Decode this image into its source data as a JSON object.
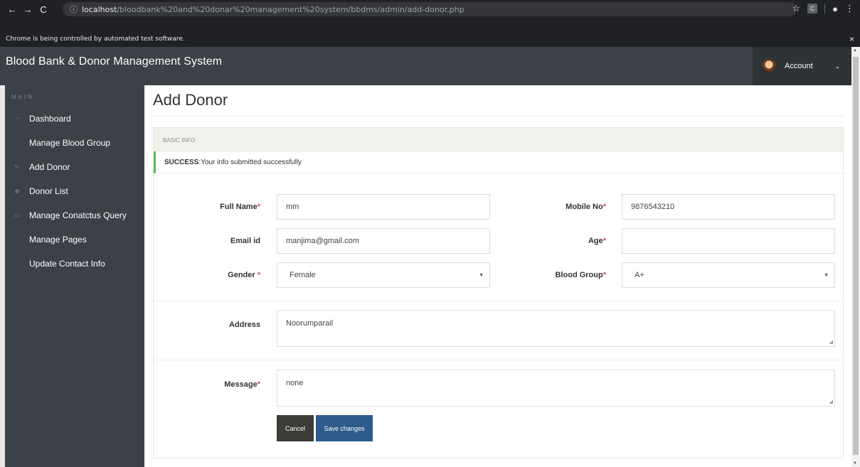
{
  "browser": {
    "url_host": "localhost",
    "url_path": "/bloodbank%20and%20donar%20management%20system/bbdms/admin/add-donor.php",
    "automation_notice": "Chrome is being controlled by automated test software.",
    "extension_label": "C"
  },
  "header": {
    "app_title": "Blood Bank & Donor Management System",
    "account_label": "Account"
  },
  "sidebar": {
    "heading": "MAIN",
    "items": [
      {
        "label": "Dashboard",
        "icon": "dashboard-icon"
      },
      {
        "label": "Manage Blood Group",
        "icon": "circle-icon"
      },
      {
        "label": "Add Donor",
        "icon": "edit-icon"
      },
      {
        "label": "Donor List",
        "icon": "users-icon"
      },
      {
        "label": "Manage Conatctus Query",
        "icon": "desktop-icon"
      },
      {
        "label": "Manage Pages",
        "icon": "circle-icon"
      },
      {
        "label": "Update Contact Info",
        "icon": "circle-icon"
      }
    ]
  },
  "main": {
    "page_title": "Add Donor",
    "panel_heading": "BASIC INFO",
    "alert": {
      "strong": "SUCCESS",
      "message": ":Your info submitted successfully"
    },
    "fields": {
      "full_name": {
        "label": "Full Name",
        "required": "*",
        "value": "mm"
      },
      "mobile_no": {
        "label": "Mobile No",
        "required": "*",
        "value": "9876543210"
      },
      "email": {
        "label": "Email id",
        "value": "manjima@gmail.com"
      },
      "age": {
        "label": "Age",
        "required": "*",
        "value": ""
      },
      "gender": {
        "label": "Gender ",
        "required": "*",
        "value": "Female"
      },
      "blood_group": {
        "label": "Blood Group",
        "required": "*",
        "value": "A+"
      },
      "address": {
        "label": "Address",
        "value": "Noorumparail"
      },
      "message": {
        "label": "Message",
        "required": "*",
        "value": "none"
      }
    },
    "buttons": {
      "cancel": "Cancel",
      "save": "Save changes"
    }
  },
  "colors": {
    "header_bg": "#3b4146",
    "success_accent": "#5cb85c",
    "save_button": "#2f5b8c",
    "required_star": "#d9534f"
  }
}
